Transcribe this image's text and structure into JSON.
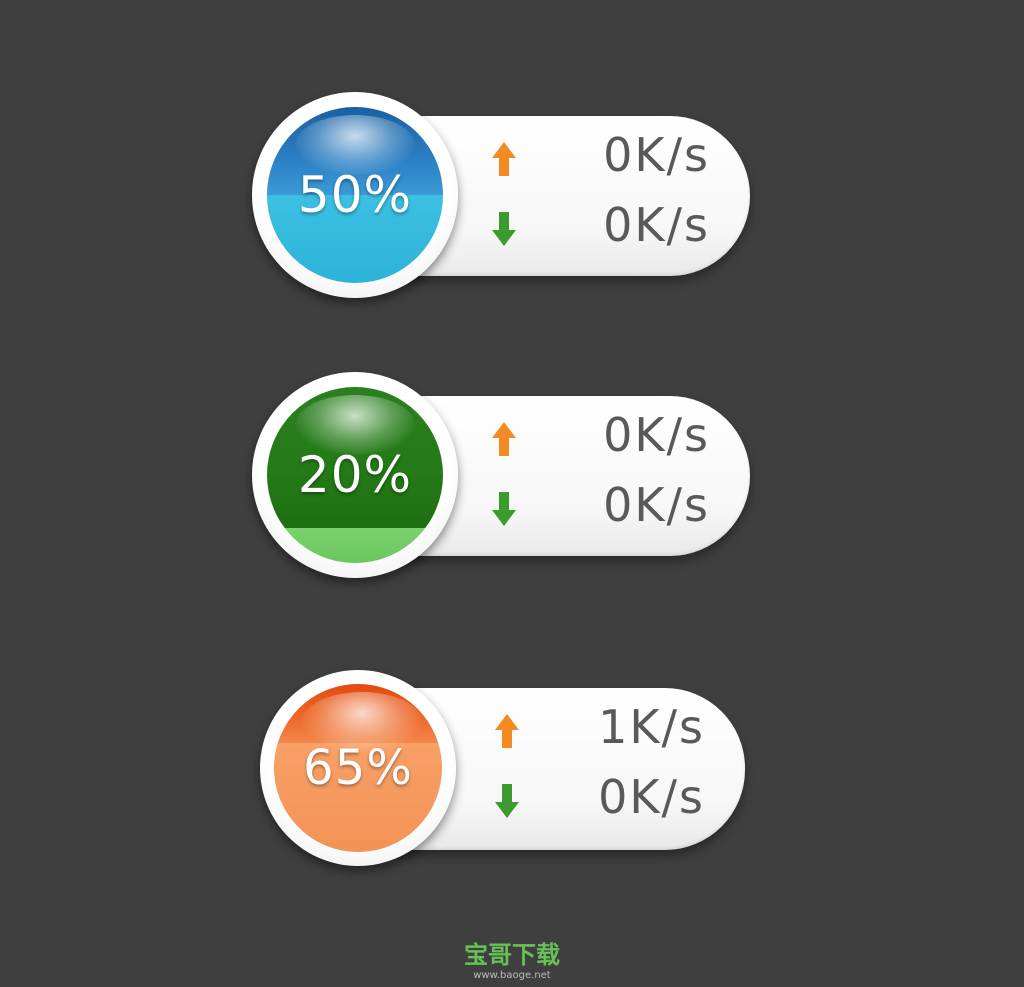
{
  "colors": {
    "background": "#3f3f3f",
    "upload_arrow": "#f38a24",
    "download_arrow": "#3d9a2e",
    "rate_text": "#595959"
  },
  "widgets": [
    {
      "theme": "blue",
      "percent_label": "50%",
      "fill_fraction": 0.5,
      "upload_rate": "0K/s",
      "download_rate": "0K/s",
      "upload_icon": "arrow-up-icon",
      "download_icon": "arrow-down-icon"
    },
    {
      "theme": "green",
      "percent_label": "20%",
      "fill_fraction": 0.2,
      "upload_rate": "0K/s",
      "download_rate": "0K/s",
      "upload_icon": "arrow-up-icon",
      "download_icon": "arrow-down-icon"
    },
    {
      "theme": "orange",
      "percent_label": "65%",
      "fill_fraction": 0.65,
      "upload_rate": "1K/s",
      "download_rate": "0K/s",
      "upload_icon": "arrow-up-icon",
      "download_icon": "arrow-down-icon"
    }
  ],
  "watermark": {
    "logo_text": "宝哥下载",
    "url": "www.baoge.net"
  }
}
